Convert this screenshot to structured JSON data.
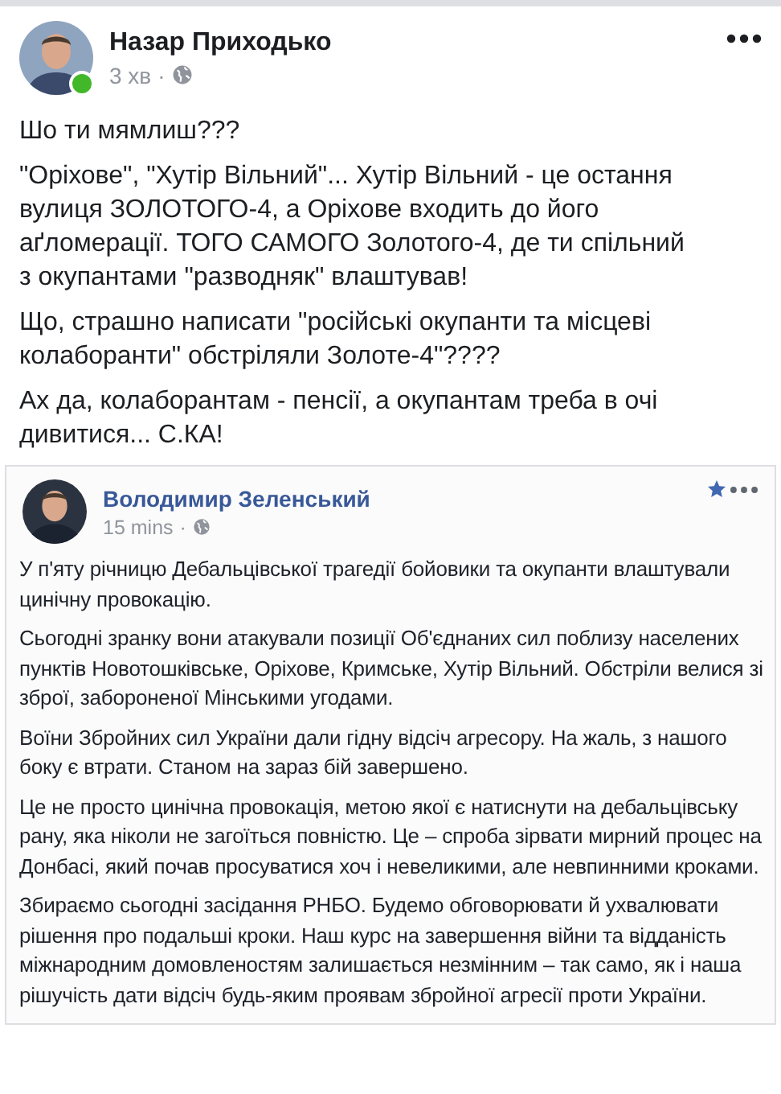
{
  "post": {
    "author": "Назар Приходько",
    "online": true,
    "time": "3 хв",
    "separator": "·",
    "paragraphs": [
      "Шо ти мямлиш???",
      "\"Оріхове\", \"Хутір Вільний\"... Хутір Вільний - це остання вулиця ЗОЛОТОГО-4, а Оріхове входить до його аґломерації. ТОГО САМОГО Золотого-4, де ти спільний з окупантами \"разводняк\" влаштував!",
      "Що, страшно написати \"російські окупанти та місцеві колаборанти\" обстріляли Золоте-4\"????",
      "Ах да, колаборантам - пенсії, а окупантам треба в очі дивитися... С.КА!"
    ]
  },
  "shared_post": {
    "author": "Володимир Зеленський",
    "time": "15 mins",
    "separator": "·",
    "paragraphs": [
      "У п'яту річницю Дебальцівської трагедії бойовики та окупанти влаштували цинічну провокацію.",
      "Сьогодні зранку вони атакували позиції Об'єднаних сил поблизу населених пунктів Новотошківське, Оріхове, Кримське, Хутір Вільний. Обстріли велися зі зброї, забороненої Мінськими угодами.",
      "Воїни Збройних сил України дали гідну відсіч агресору. На жаль, з нашого боку є втрати. Станом на зараз бій завершено.",
      "Це не просто цинічна провокація, метою якої є натиснути на дебальцівську рану, яка ніколи не загоїться повністю. Це – спроба зірвати мирний процес на Донбасі, який почав просуватися хоч і невеликими, але невпинними кроками.",
      "Збираємо сьогодні засідання РНБО. Будемо обговорювати й ухвалювати рішення про подальші кроки. Наш курс на завершення війни та відданість міжнародним домовленостям залишається незмінним – так само, як і наша рішучість дати відсіч будь-яким проявам збройної агресії проти України."
    ]
  }
}
